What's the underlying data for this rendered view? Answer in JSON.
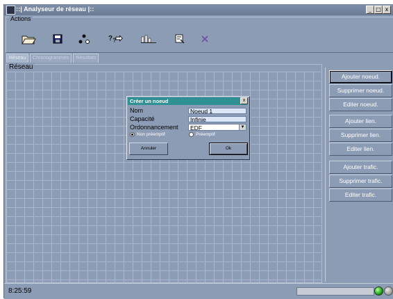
{
  "window": {
    "title": "::| Analyseur de réseau |::",
    "controls": {
      "minimize": "_",
      "maximize": "□",
      "close": "x"
    }
  },
  "actions": {
    "legend": "Actions",
    "tools": [
      {
        "icon": "open-folder-icon"
      },
      {
        "icon": "save-icon"
      },
      {
        "icon": "network-icon"
      },
      {
        "icon": "analyze-icon"
      },
      {
        "icon": "chart-icon"
      },
      {
        "icon": "export-icon"
      },
      {
        "icon": "close-cross-icon"
      }
    ]
  },
  "tabs": [
    "Réseau",
    "Chronogrammes",
    "Résultats"
  ],
  "network": {
    "legend": "Réseau"
  },
  "side_buttons": [
    "Ajouter noeud.",
    "Supprimer noeud.",
    "Editer noeud.",
    "Ajouter lien.",
    "Supprimer lien.",
    "Editer lien.",
    "Ajouter trafic.",
    "Supprimer trafic.",
    "Editer trafic."
  ],
  "dialog": {
    "title": "Créer un noeud",
    "close": "x",
    "fields": {
      "nom_label": "Nom",
      "nom_value": "Noeud 1",
      "capacite_label": "Capacité",
      "capacite_value": "Infinie",
      "ordonnancement_label": "Ordonnancement",
      "ordonnancement_value": "EDF"
    },
    "radios": {
      "non_preemptif": "Non préemptif",
      "preemptif": "Préemptif",
      "selected": "non_preemptif"
    },
    "buttons": {
      "cancel": "Annuler",
      "ok": "Ok"
    }
  },
  "status": {
    "time": "8:25:59",
    "progress": 0
  },
  "colors": {
    "background": "#8d9cb5",
    "dialog_title": "#2f9194",
    "led_ok": "#21a21a"
  }
}
